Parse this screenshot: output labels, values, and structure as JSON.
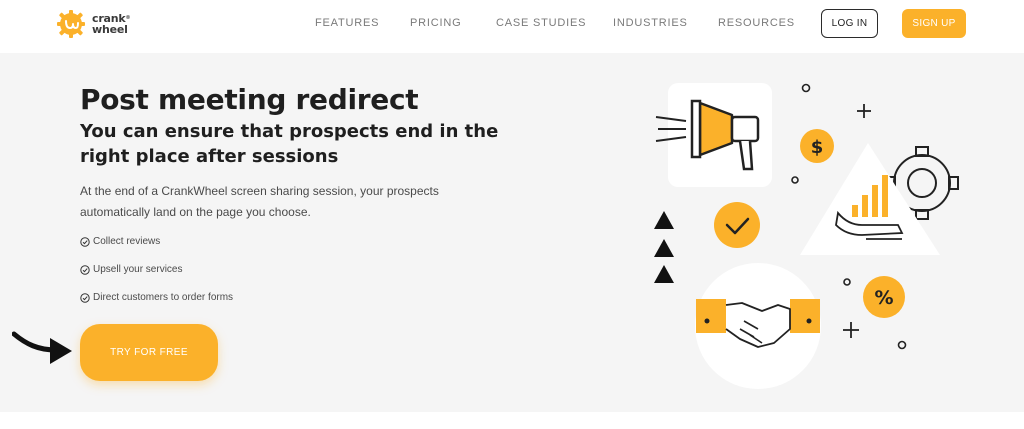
{
  "brand": {
    "name_line1": "crank",
    "name_line2": "wheel",
    "registered": "®",
    "accent_color": "#fbb12a"
  },
  "nav": {
    "items": [
      "FEATURES",
      "PRICING",
      "CASE STUDIES",
      "INDUSTRIES",
      "RESOURCES"
    ],
    "login_label": "LOG IN",
    "signup_label": "SIGN UP"
  },
  "hero": {
    "title": "Post meeting redirect",
    "subtitle": "You can ensure that prospects end in the right place after sessions",
    "description": "At the end of a CrankWheel screen sharing session, your prospects automatically land on the page you choose.",
    "checklist": [
      "Collect reviews",
      "Upsell your services",
      "Direct customers to order forms"
    ],
    "cta_label": "TRY FOR FREE"
  },
  "illustration": {
    "dollar_symbol": "$",
    "percent_symbol": "%",
    "icons": [
      "megaphone-icon",
      "dollar-coin-icon",
      "check-coin-icon",
      "gear-icon",
      "growth-chart-hand-icon",
      "handshake-icon",
      "percent-coin-icon",
      "triangle-arrows-icon",
      "plus-icon",
      "circle-dot-icon"
    ]
  }
}
